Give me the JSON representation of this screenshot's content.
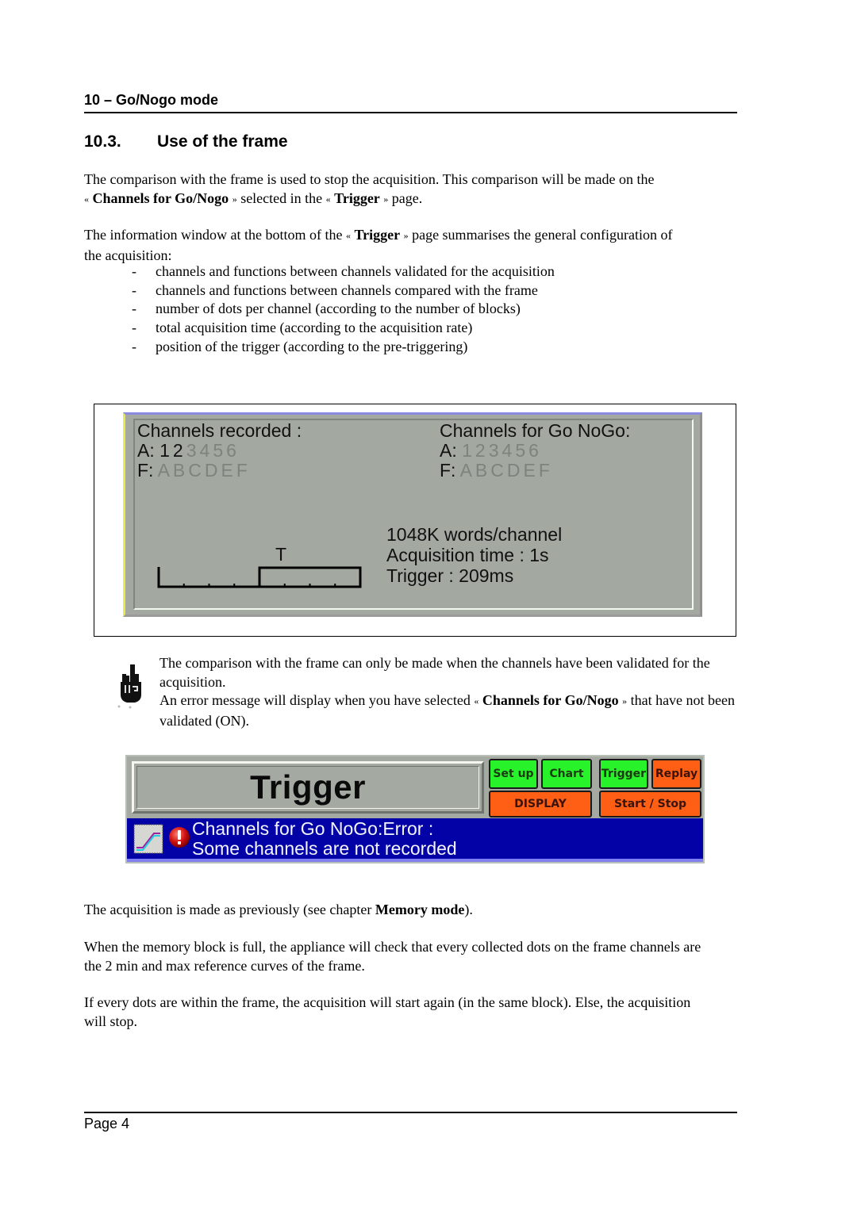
{
  "header": {
    "chapter": "10 – Go/Nogo mode"
  },
  "section": {
    "number": "10.3.",
    "title": "Use of the frame"
  },
  "paragraphs": {
    "p1": {
      "a": "The comparison with the frame is used to stop the acquisition. This comparison will be made on the",
      "open_quote": "«",
      "bold1": "Channels for Go/Nogo",
      "close_quote": "»",
      "b": "selected in the",
      "bold2": "Trigger",
      "c": "page."
    },
    "p2": {
      "a": "The information window at the bottom of the",
      "open_quote": "«",
      "bold1": "Trigger",
      "close_quote": "»",
      "b": "page summarises the general configuration of the acquisition:"
    },
    "bullets": [
      "channels and functions between channels validated for the acquisition",
      "channels and functions between channels compared with the frame",
      "number of dots per channel (according to the number of blocks)",
      "total acquisition time (according to the acquisition rate)",
      "position of the trigger (according to the pre-triggering)"
    ],
    "bullet_marker": "-",
    "p3": {
      "a": "The acquisition is made as previously (see chapter",
      "bold1": "Memory mode",
      "b": ")."
    },
    "p4": "When the memory block is full, the appliance will check that every collected dots on the frame channels are the 2 min and max reference curves of the frame.",
    "p5": "If every dots are within the frame, the acquisition will start again (in the same block). Else, the acquisition will stop."
  },
  "figure1": {
    "recorded_title": "Channels recorded :",
    "gonogo_title": "Channels for Go NoGo:",
    "analog_prefix": "A:",
    "function_prefix": "F:",
    "recorded_analog": [
      {
        "label": "1",
        "active": true
      },
      {
        "label": "2",
        "active": true
      },
      {
        "label": "3",
        "active": false
      },
      {
        "label": "4",
        "active": false
      },
      {
        "label": "5",
        "active": false
      },
      {
        "label": "6",
        "active": false
      }
    ],
    "recorded_functions": [
      {
        "label": "A",
        "active": false
      },
      {
        "label": "B",
        "active": false
      },
      {
        "label": "C",
        "active": false
      },
      {
        "label": "D",
        "active": false
      },
      {
        "label": "E",
        "active": false
      },
      {
        "label": "F",
        "active": false
      }
    ],
    "gonogo_analog": [
      {
        "label": "1",
        "active": false
      },
      {
        "label": "2",
        "active": false
      },
      {
        "label": "3",
        "active": false
      },
      {
        "label": "4",
        "active": false
      },
      {
        "label": "5",
        "active": false
      },
      {
        "label": "6",
        "active": false
      }
    ],
    "gonogo_functions": [
      {
        "label": "A",
        "active": false
      },
      {
        "label": "B",
        "active": false
      },
      {
        "label": "C",
        "active": false
      },
      {
        "label": "D",
        "active": false
      },
      {
        "label": "E",
        "active": false
      },
      {
        "label": "F",
        "active": false
      }
    ],
    "trigger_marker": "T",
    "trigger_position_fraction": 0.5,
    "words_per_channel": "1048K words/channel",
    "acquisition_time": "Acquisition time : 1s",
    "trigger_time": "Trigger : 209ms"
  },
  "note": {
    "line1": "The comparison with the frame can only be made when the channels have been validated for the acquisition.",
    "line2_a": "An error message will display when you have selected",
    "open_quote": "«",
    "bold1": "Channels for Go/Nogo",
    "close_quote": "»",
    "line2_b": "that have not been validated (ON)."
  },
  "figure2": {
    "title": "Trigger",
    "buttons": {
      "setup": "Set up",
      "chart": "Chart",
      "trigger": "Trigger",
      "replay": "Replay",
      "display": "DISPLAY",
      "start_stop": "Start / Stop"
    },
    "status_line1": "Channels for Go NoGo:Error :",
    "status_line2": "Some channels are not recorded",
    "colors": {
      "button_green": "#27f22a",
      "button_orange": "#fe5f14",
      "status_bar": "#0202a6",
      "lcd_background": "#a4a9a2"
    }
  },
  "footer": {
    "page": "Page 4"
  }
}
